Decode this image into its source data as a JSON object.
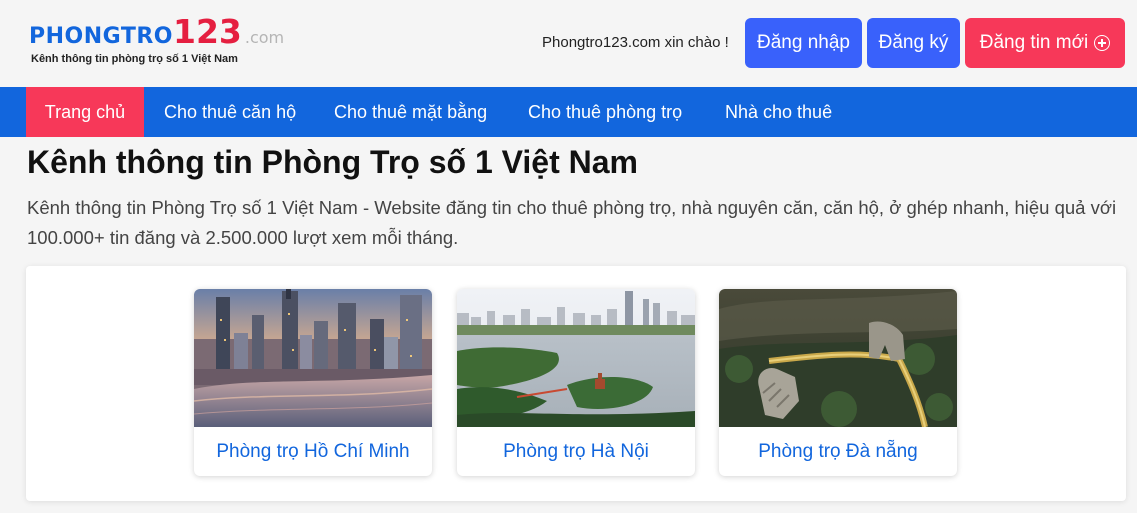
{
  "header": {
    "logo": {
      "word": "PHONGTRO",
      "number": "123",
      "domain": ".com",
      "tagline": "Kênh thông tin phòng trọ số 1 Việt Nam"
    },
    "welcome": "Phongtro123.com xin chào !",
    "login_label": "Đăng nhập",
    "register_label": "Đăng ký",
    "post_label": "Đăng tin mới",
    "post_icon": "plus-circle-icon"
  },
  "nav": {
    "items": [
      {
        "label": "Trang chủ",
        "active": true
      },
      {
        "label": "Cho thuê căn hộ",
        "active": false
      },
      {
        "label": "Cho thuê mặt bằng",
        "active": false
      },
      {
        "label": "Cho thuê phòng trọ",
        "active": false
      },
      {
        "label": "Nhà cho thuê",
        "active": false
      }
    ]
  },
  "main": {
    "title": "Kênh thông tin Phòng Trọ số 1 Việt Nam",
    "description": "Kênh thông tin Phòng Trọ số 1 Việt Nam - Website đăng tin cho thuê phòng trọ, nhà nguyên căn, căn hộ, ở ghép nhanh, hiệu quả với 100.000+ tin đăng và 2.500.000 lượt xem mỗi tháng.",
    "locations": [
      {
        "label": "Phòng trọ Hồ Chí Minh"
      },
      {
        "label": "Phòng trọ Hà Nội"
      },
      {
        "label": "Phòng trọ Đà nẵng"
      }
    ]
  },
  "colors": {
    "brand_blue": "#1266dd",
    "button_blue": "#3961fb",
    "accent_red": "#f73859",
    "background": "#f5f5f5"
  }
}
